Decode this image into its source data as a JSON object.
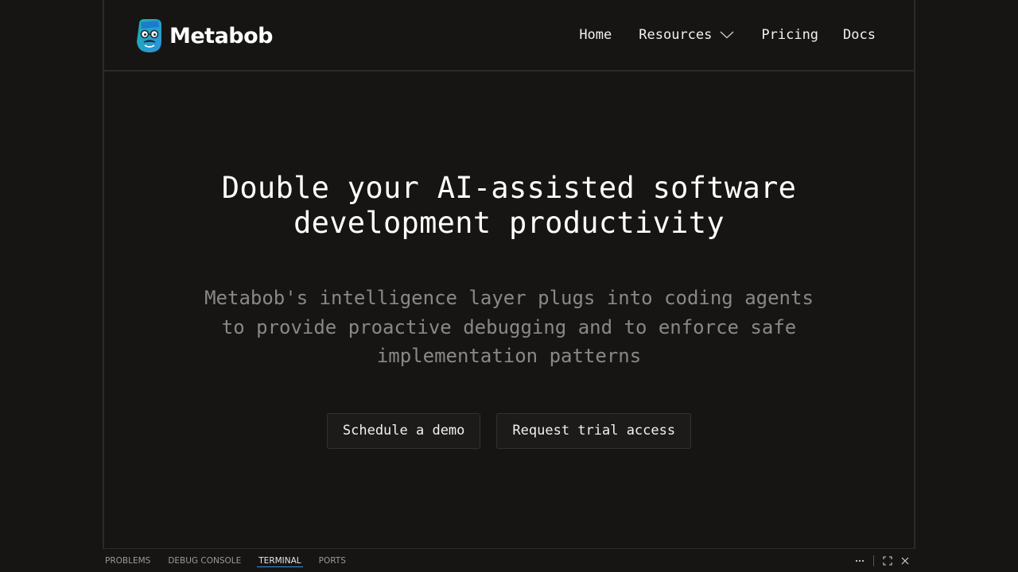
{
  "brand": {
    "name": "Metabob",
    "logo_colors": {
      "primary": "#2f8fe0",
      "secondary": "#18b4a8",
      "dark": "#1e2a3a"
    }
  },
  "nav": {
    "items": [
      {
        "label": "Home"
      },
      {
        "label": "Resources",
        "has_dropdown": true
      },
      {
        "label": "Pricing"
      },
      {
        "label": "Docs"
      }
    ]
  },
  "hero": {
    "title_line1": "Double your AI-assisted software",
    "title_line2": "development productivity",
    "subtitle_line1": "Metabob's intelligence layer plugs into coding agents",
    "subtitle_line2": "to provide proactive debugging and to enforce safe",
    "subtitle_line3": "implementation patterns",
    "cta_primary": "Schedule a demo",
    "cta_secondary": "Request trial access"
  },
  "panel": {
    "tabs": [
      {
        "label": "PROBLEMS"
      },
      {
        "label": "DEBUG CONSOLE"
      },
      {
        "label": "TERMINAL",
        "active": true
      },
      {
        "label": "PORTS"
      }
    ],
    "actions": [
      "more-icon",
      "maximize-icon",
      "close-icon"
    ]
  },
  "theme": {
    "background": "#161514",
    "border": "#2c2b2a",
    "text": "#f1f1f1",
    "muted_text": "#8a8886",
    "active_tab_accent": "#3c8fdd"
  }
}
